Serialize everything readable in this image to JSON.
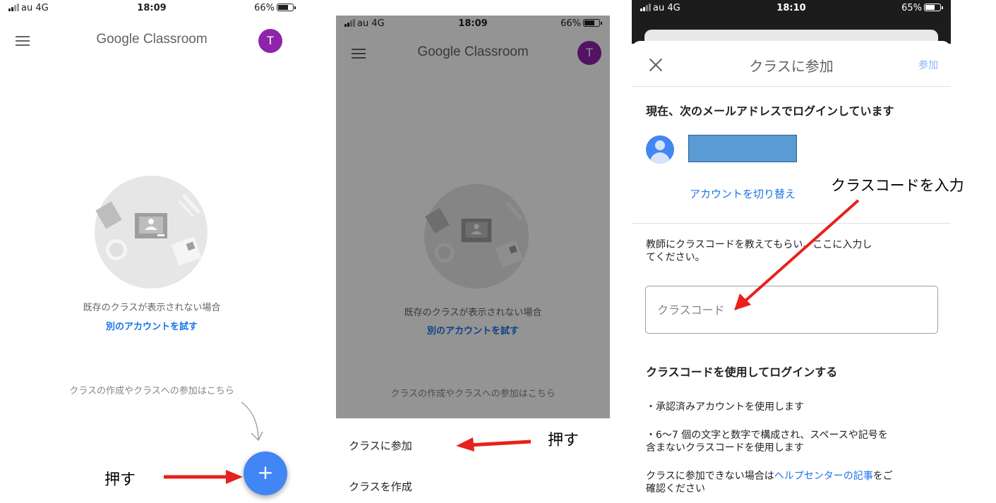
{
  "panel1": {
    "status": {
      "carrier": "au 4G",
      "time": "18:09",
      "battery": "66%"
    },
    "app_title": "Google Classroom",
    "avatar_letter": "T",
    "no_class_msg": "既存のクラスが表示されない場合",
    "try_other_account": "別のアカウントを試す",
    "hint": "クラスの作成やクラスへの参加はこちら",
    "fab_symbol": "+",
    "annotation": "押す",
    "colors": {
      "fab": "#4285f4",
      "avatar": "#8e24aa",
      "link": "#1a73e8",
      "arrow": "#e8211c"
    }
  },
  "panel2": {
    "status": {
      "carrier": "au 4G",
      "time": "18:09",
      "battery": "66%"
    },
    "app_title": "Google Classroom",
    "avatar_letter": "T",
    "no_class_msg": "既存のクラスが表示されない場合",
    "try_other_account": "別のアカウントを試す",
    "hint": "クラスの作成やクラスへの参加はこちら",
    "menu": [
      {
        "label": "クラスに参加"
      },
      {
        "label": "クラスを作成"
      }
    ],
    "annotation": "押す"
  },
  "panel3": {
    "status": {
      "carrier": "au 4G",
      "time": "18:10",
      "battery": "65%"
    },
    "dialog_title": "クラスに参加",
    "join_label": "参加",
    "logged_in_heading": "現在、次のメールアドレスでログインしています",
    "switch_account": "アカウントを切り替え",
    "instruction_line1": "教師にクラスコードを教えてもらい、ここに入力し",
    "instruction_line2": "てください。",
    "code_placeholder": "クラスコード",
    "code_value": "",
    "login_heading": "クラスコードを使用してログインする",
    "bullet1": "・承認済みアカウントを使用します",
    "bullet2_line1": "・6〜7 個の文字と数字で構成され、スペースや記号を",
    "bullet2_line2": "含まないクラスコードを使用します",
    "help_prefix": "クラスに参加できない場合は",
    "help_link": "ヘルプセンターの記事",
    "help_suffix": "をご",
    "help_line2": "確認ください"
  },
  "annotation_enter_code": "クラスコードを入力"
}
